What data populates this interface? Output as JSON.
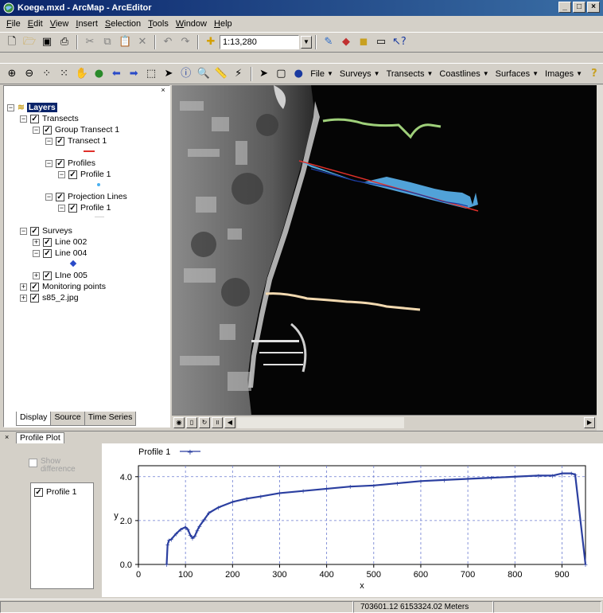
{
  "window": {
    "title": "Koege.mxd - ArcMap - ArcEditor"
  },
  "menu": [
    "File",
    "Edit",
    "View",
    "Insert",
    "Selection",
    "Tools",
    "Window",
    "Help"
  ],
  "toolbar": {
    "scale": "1:13,280"
  },
  "custom_menus": [
    "File",
    "Surveys",
    "Transects",
    "Coastlines",
    "Surfaces",
    "Images"
  ],
  "toc": {
    "root": "Layers",
    "transects": "Transects",
    "group_transect": "Group Transect 1",
    "transect1": "Transect 1",
    "profiles": "Profiles",
    "profile1": "Profile 1",
    "projection_lines": "Projection Lines",
    "proj_profile1": "Profile 1",
    "surveys": "Surveys",
    "line002": "Line 002",
    "line004": "Line 004",
    "line005": "LIne 005",
    "monitoring": "Monitoring points",
    "image": "s85_2.jpg",
    "tabs": [
      "Display",
      "Source",
      "Time Series"
    ]
  },
  "dock": {
    "tab": "Profile Plot",
    "show_difference": "Show difference",
    "profile_item": "Profile 1"
  },
  "status": {
    "coords": "703601.12  6153324.02 Meters"
  },
  "colors": {
    "profile_line": "#2b3fa0",
    "transect": "#e0302a",
    "fill": "#5ab4f0"
  },
  "chart_data": {
    "type": "line",
    "legend": "Profile 1",
    "xlabel": "x",
    "ylabel": "y",
    "xlim": [
      0,
      950
    ],
    "ylim": [
      0,
      4.5
    ],
    "xticks": [
      0,
      100,
      200,
      300,
      400,
      500,
      600,
      700,
      800,
      900
    ],
    "yticks": [
      "0.0",
      "2.0",
      "4.0"
    ],
    "grid": true,
    "series": [
      {
        "name": "Profile 1",
        "x": [
          60,
          62,
          65,
          70,
          80,
          90,
          100,
          105,
          110,
          115,
          120,
          125,
          130,
          140,
          150,
          170,
          200,
          230,
          260,
          300,
          350,
          400,
          450,
          500,
          550,
          600,
          650,
          700,
          750,
          800,
          850,
          880,
          900,
          920,
          928,
          950
        ],
        "y": [
          0.0,
          0.9,
          1.1,
          1.15,
          1.4,
          1.6,
          1.7,
          1.6,
          1.35,
          1.2,
          1.3,
          1.55,
          1.75,
          2.05,
          2.35,
          2.6,
          2.85,
          3.0,
          3.1,
          3.25,
          3.35,
          3.45,
          3.55,
          3.6,
          3.7,
          3.8,
          3.85,
          3.9,
          3.95,
          4.0,
          4.05,
          4.05,
          4.15,
          4.15,
          4.1,
          0.0
        ]
      }
    ]
  }
}
